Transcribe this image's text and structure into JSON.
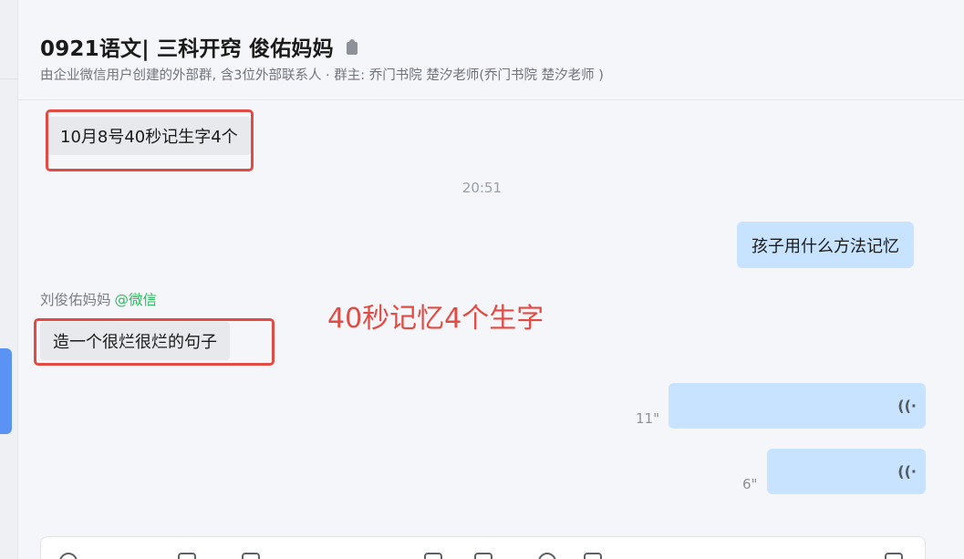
{
  "header": {
    "title": "0921语文| 三科开窍 俊佑妈妈",
    "lock_icon": "lock-icon",
    "subtitle": "由企业微信用户创建的外部群, 含3位外部联系人 · 群主: 乔门书院 楚汐老师(乔门书院 楚汐老师 )"
  },
  "messages": {
    "first_incoming": "10月8号40秒记生字4个",
    "timestamp": "20:51",
    "outgoing_question": "孩子用什么方法记忆",
    "sender_name": "刘俊佑妈妈",
    "sender_tag": "@微信",
    "second_incoming": "造一个很烂很烂的句子",
    "voice_1_duration": "11\"",
    "voice_2_duration": "6\"",
    "voice_icon": "voice-wave-icon"
  },
  "annotation": "40秒记忆4个生字",
  "colors": {
    "highlight": "#e24b43",
    "outgoing_bubble": "#c7e3ff",
    "incoming_bubble": "#e7e9ed",
    "wechat_tag": "#2bbd5c",
    "active_tab": "#5b93f5"
  }
}
